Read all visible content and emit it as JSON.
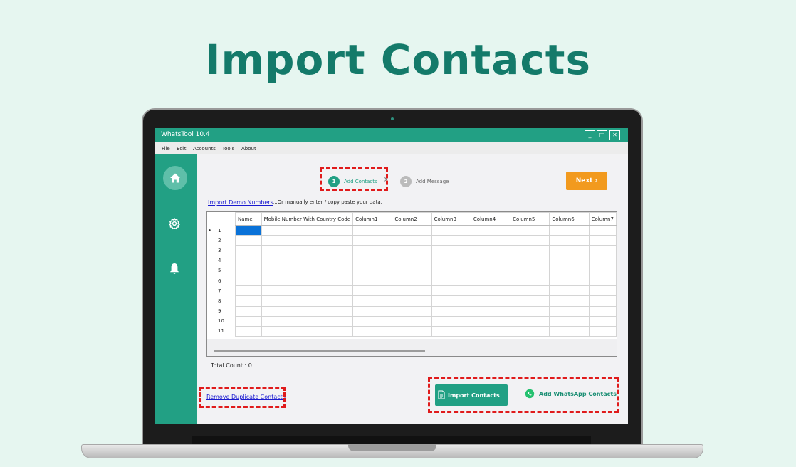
{
  "hero": {
    "title": "Import Contacts"
  },
  "window": {
    "title": "WhatsTool 10.4",
    "minimize": "_",
    "maximize": "□",
    "close": "✕"
  },
  "menu": [
    "File",
    "Edit",
    "Accounts",
    "Tools",
    "About"
  ],
  "steps": [
    {
      "number": "1",
      "label": "Add Contacts"
    },
    {
      "number": "2",
      "label": "Add Message"
    }
  ],
  "step_separator": "›",
  "next_button": "Next ›",
  "import_demo_link": "Import Demo Numbers",
  "manual_note": "...Or manually enter / copy paste your data.",
  "grid": {
    "columns": [
      "Name",
      "Mobile Number With Country Code",
      "Column1",
      "Column2",
      "Column3",
      "Column4",
      "Column5",
      "Column6",
      "Column7"
    ],
    "rows": [
      "1",
      "2",
      "3",
      "4",
      "5",
      "6",
      "7",
      "8",
      "9",
      "10",
      "11"
    ],
    "current_row_marker": "▸"
  },
  "total_count": "Total Count :  0",
  "remove_duplicates_link": "Remove Duplicate Contacts",
  "import_contacts_button": "Import Contacts",
  "add_whatsapp_button": "Add WhatsApp Contacts",
  "colors": {
    "brand_green": "#22a084",
    "hero_text": "#147a6a",
    "next_orange": "#f29a1e",
    "highlight_red": "#e01b1b",
    "selection_blue": "#0a72d8"
  },
  "icons": [
    "home-icon",
    "gear-icon",
    "bell-icon",
    "document-icon",
    "whatsapp-icon"
  ]
}
